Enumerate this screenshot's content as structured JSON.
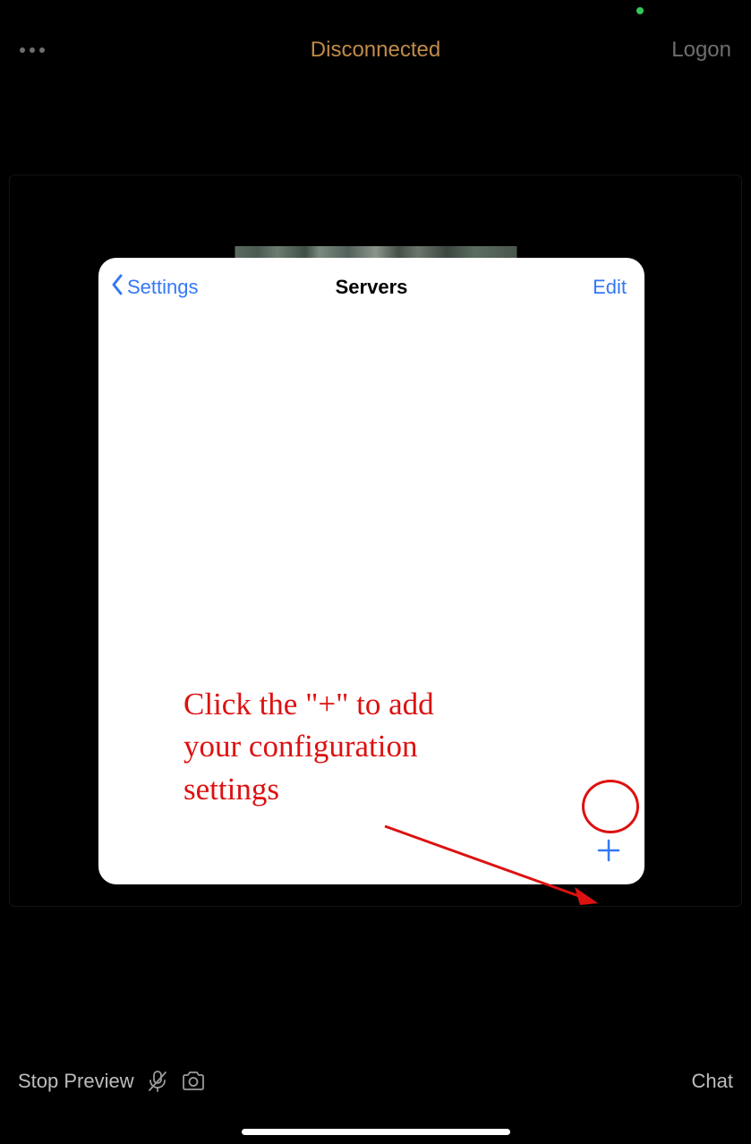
{
  "topbar": {
    "title": "Disconnected",
    "logon_label": "Logon"
  },
  "modal": {
    "back_label": "Settings",
    "title": "Servers",
    "edit_label": "Edit"
  },
  "annotation": {
    "text": "Click the \"+\" to add\nyour configuration\nsettings"
  },
  "bottombar": {
    "stop_preview_label": "Stop Preview",
    "chat_label": "Chat"
  },
  "colors": {
    "accent_orange": "#c08a4a",
    "ios_blue": "#3478f6",
    "annotation_red": "#dd1111",
    "status_green": "#34c759"
  }
}
